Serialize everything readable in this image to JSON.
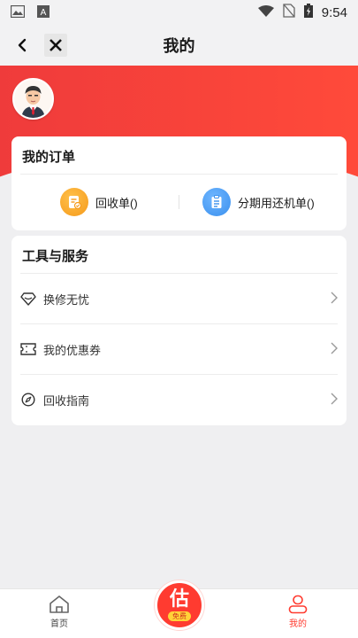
{
  "status_bar": {
    "time": "9:54",
    "icons": [
      "image-icon",
      "text-a-icon",
      "wifi-icon",
      "no-sim-icon",
      "battery-icon"
    ]
  },
  "header": {
    "title": "我的",
    "back_icon": "chevron-left-icon",
    "close_icon": "close-x-icon"
  },
  "colors": {
    "accent": "#ff3b30",
    "header_red": "#ef3b3b",
    "order_icon_orange": "#f7a325",
    "order_icon_blue": "#3e9cf5"
  },
  "orders": {
    "title": "我的订单",
    "items": [
      {
        "label": "回收单()",
        "icon": "recycle-order-icon"
      },
      {
        "label": "分期用还机单()",
        "icon": "clipboard-icon"
      }
    ]
  },
  "tools": {
    "title": "工具与服务",
    "items": [
      {
        "label": "换修无忧",
        "icon": "diamond-icon"
      },
      {
        "label": "我的优惠券",
        "icon": "ticket-icon"
      },
      {
        "label": "回收指南",
        "icon": "compass-icon"
      }
    ]
  },
  "bottom_nav": {
    "home": {
      "label": "首页",
      "icon": "home-icon"
    },
    "center": {
      "char": "估",
      "badge": "免费"
    },
    "mine": {
      "label": "我的",
      "icon": "user-icon"
    }
  }
}
